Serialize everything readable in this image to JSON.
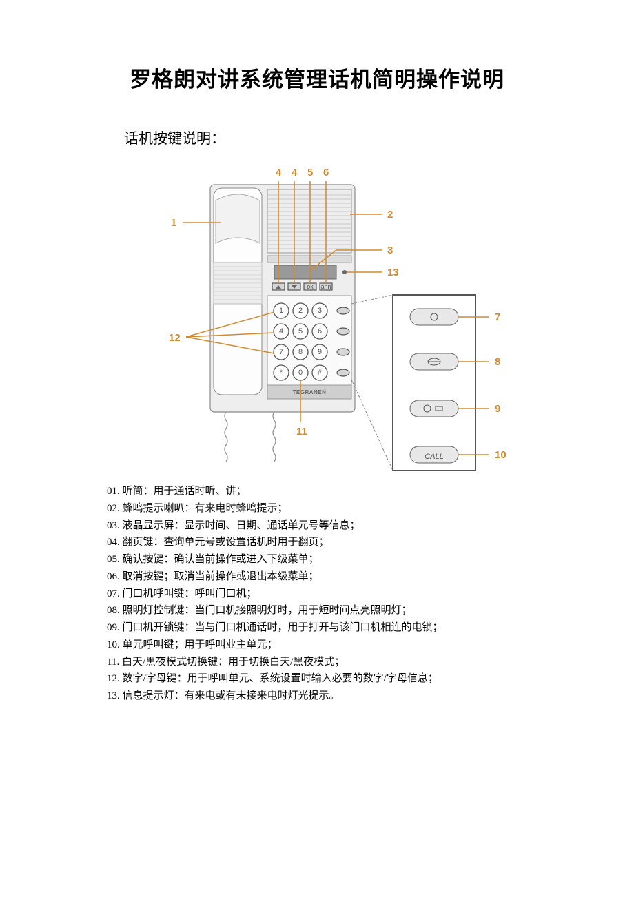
{
  "title": "罗格朗对讲系统管理话机简明操作说明",
  "subhead": "话机按键说明：",
  "diagram": {
    "callouts": {
      "c1": "1",
      "c2": "2",
      "c3": "3",
      "c4a": "4",
      "c4b": "4",
      "c5": "5",
      "c6": "6",
      "c7": "7",
      "c8": "8",
      "c9": "9",
      "c10": "10",
      "c11": "11",
      "c12": "12",
      "c13": "13"
    },
    "keys": {
      "k1": "1",
      "k2": "2",
      "k3": "3",
      "k4": "4",
      "k5": "5",
      "k6": "6",
      "k7": "7",
      "k8": "8",
      "k9": "9",
      "kstar": "*",
      "k0": "0",
      "khash": "#"
    },
    "menu": {
      "ok": "ok",
      "ann": "ann"
    },
    "brand": "TEGRANEN",
    "sidekeys": {
      "s7": "O",
      "s8": "⊘",
      "s9": "O",
      "s10": "CALL"
    }
  },
  "descriptions": [
    "01. 听筒：用于通话时听、讲；",
    "02. 蜂鸣提示喇叭：有来电时蜂鸣提示；",
    "03. 液晶显示屏：显示时间、日期、通话单元号等信息；",
    "04. 翻页键：查询单元号或设置话机时用于翻页；",
    "05. 确认按键：确认当前操作或进入下级菜单；",
    "06. 取消按键；取消当前操作或退出本级菜单；",
    "07. 门口机呼叫键：呼叫门口机；",
    "08. 照明灯控制键：当门口机接照明灯时，用于短时间点亮照明灯；",
    "09. 门口机开锁键：当与门口机通话时，用于打开与该门口机相连的电锁；",
    "10.  单元呼叫键；用于呼叫业主单元；",
    "11.  白天/黑夜模式切换键：用于切换白天/黑夜模式；",
    "12.  数字/字母键：用于呼叫单元、系统设置时输入必要的数字/字母信息；",
    "13.  信息提示灯：有来电或有未接来电时灯光提示。"
  ]
}
